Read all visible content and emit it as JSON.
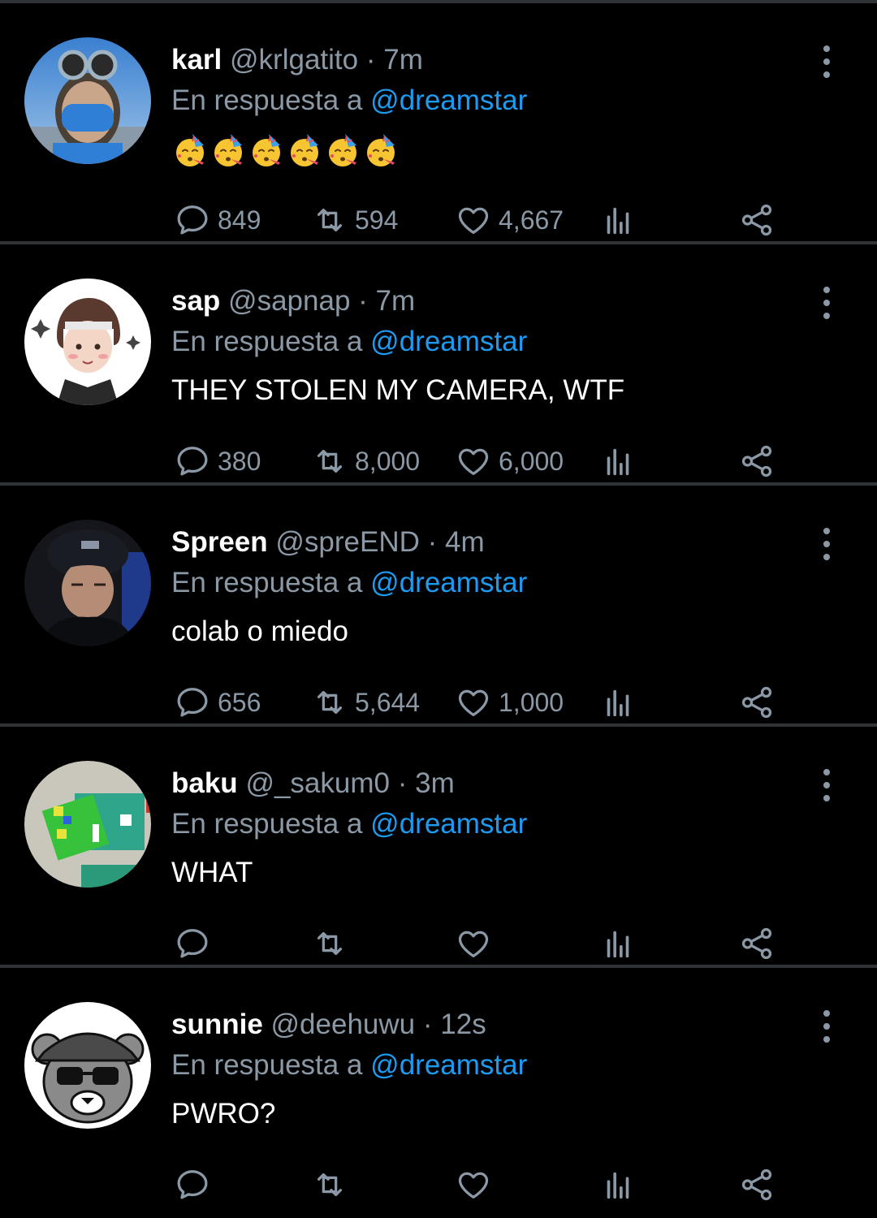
{
  "reply_prefix": "En respuesta a",
  "tweets": [
    {
      "name": "karl",
      "handle": "@krlgatito",
      "separator": "·",
      "time": "7m",
      "reply_to": "@dreamstar",
      "text": "🥳🥳🥳🥳🥳🥳",
      "is_emoji": true,
      "emoji_count": 6,
      "replies": "849",
      "retweets": "594",
      "likes": "4,667",
      "avatar": "person-with-goggles-and-blue-mask"
    },
    {
      "name": "sap",
      "handle": "@sapnap",
      "separator": "·",
      "time": "7m",
      "reply_to": "@dreamstar",
      "text": "THEY STOLEN MY CAMERA, WTF",
      "is_emoji": false,
      "replies": "380",
      "retweets": "8,000",
      "likes": "6,000",
      "avatar": "drawn-character-with-headband"
    },
    {
      "name": "Spreen",
      "handle": "@spreEND",
      "separator": "·",
      "time": "4m",
      "reply_to": "@dreamstar",
      "text": "colab o miedo",
      "is_emoji": false,
      "replies": "656",
      "retweets": "5,644",
      "likes": "1,000",
      "avatar": "person-in-dark-cap"
    },
    {
      "name": "baku",
      "handle": "@_sakum0",
      "separator": "·",
      "time": "3m",
      "reply_to": "@dreamstar",
      "text": "WHAT",
      "is_emoji": false,
      "replies": "",
      "retweets": "",
      "likes": "",
      "avatar": "blocky-game-character"
    },
    {
      "name": "sunnie",
      "handle": "@deehuwu",
      "separator": "·",
      "time": "12s",
      "reply_to": "@dreamstar",
      "text": "PWRO?",
      "is_emoji": false,
      "replies": "",
      "retweets": "",
      "likes": "",
      "avatar": "bear-with-cap-and-sunglasses"
    }
  ],
  "colors": {
    "background": "#000000",
    "divider": "#2f3336",
    "muted": "#8b98a5",
    "mention": "#1d9bf0",
    "text": "#ffffff"
  },
  "icons": {
    "reply": "speech-bubble-icon",
    "retweet": "retweet-icon",
    "like": "heart-icon",
    "views": "bar-chart-icon",
    "share": "share-icon",
    "more": "vertical-dots-icon"
  }
}
